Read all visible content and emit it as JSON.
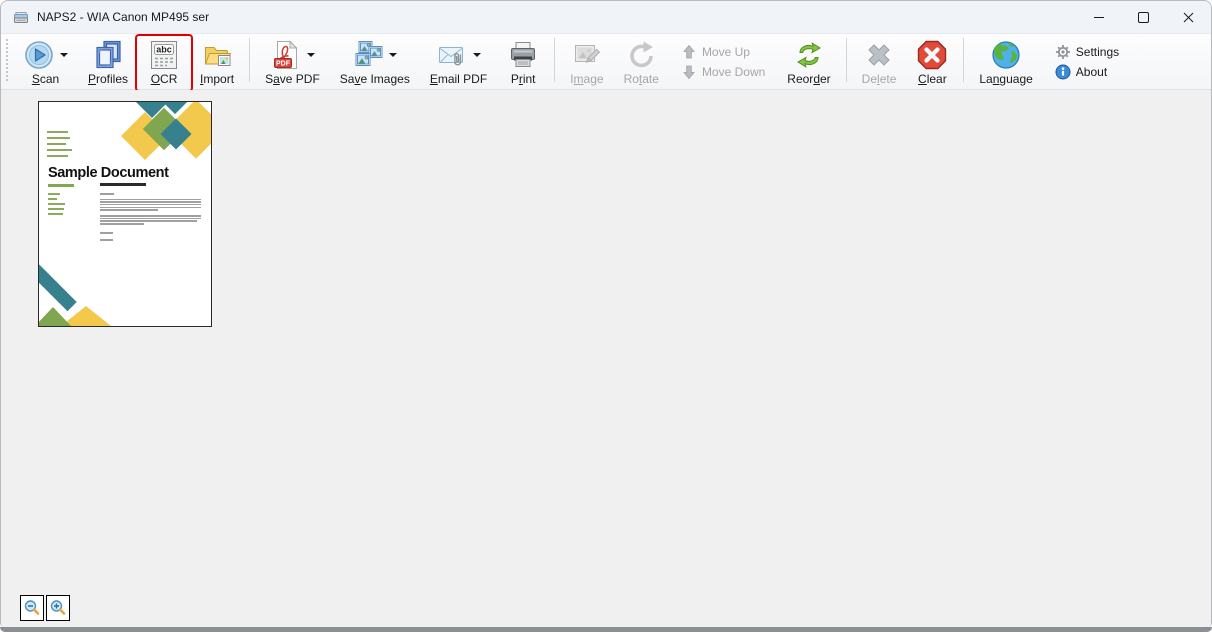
{
  "window": {
    "title": "NAPS2 - WIA Canon MP495 ser",
    "app_icon": "scanner-icon",
    "controls": [
      {
        "name": "minimize",
        "icon": "minimize-icon"
      },
      {
        "name": "maximize",
        "icon": "maximize-icon"
      },
      {
        "name": "close",
        "icon": "close-icon"
      }
    ]
  },
  "colors": {
    "ocr_highlight": "#e00000",
    "titlebar_bg": "#f0f3f8",
    "content_bg": "#f0f0f0",
    "disabled_text": "#a6a6a6",
    "window_border": "#8b8f94"
  },
  "toolbar": {
    "items": [
      {
        "type": "button",
        "name": "scan",
        "icon": "scan-icon",
        "label": {
          "pre": "",
          "key": "S",
          "post": "can"
        },
        "arrow": true,
        "enabled": true
      },
      {
        "type": "button",
        "name": "profiles",
        "icon": "profiles-icon",
        "label": {
          "pre": "",
          "key": "P",
          "post": "rofiles"
        },
        "enabled": true
      },
      {
        "type": "button",
        "name": "ocr",
        "icon": "ocr-icon",
        "label": {
          "pre": "",
          "key": "O",
          "post": "CR"
        },
        "enabled": true,
        "highlighted": true
      },
      {
        "type": "button",
        "name": "import",
        "icon": "import-icon",
        "label": {
          "pre": "",
          "key": "I",
          "post": "mport"
        },
        "enabled": true
      },
      {
        "type": "separator"
      },
      {
        "type": "button",
        "name": "save-pdf",
        "icon": "save-pdf-icon",
        "label": {
          "pre": "S",
          "key": "a",
          "post": "ve PDF"
        },
        "arrow": true,
        "enabled": true
      },
      {
        "type": "button",
        "name": "save-images",
        "icon": "save-images-icon",
        "label": {
          "pre": "Sa",
          "key": "v",
          "post": "e Images"
        },
        "arrow": true,
        "enabled": true
      },
      {
        "type": "button",
        "name": "email-pdf",
        "icon": "email-pdf-icon",
        "label": {
          "pre": "",
          "key": "E",
          "post": "mail PDF"
        },
        "arrow": true,
        "enabled": true
      },
      {
        "type": "button",
        "name": "print",
        "icon": "print-icon",
        "label": {
          "pre": "P",
          "key": "r",
          "post": "int"
        },
        "enabled": true
      },
      {
        "type": "separator"
      },
      {
        "type": "button",
        "name": "image",
        "icon": "image-icon",
        "label": {
          "pre": "I",
          "key": "m",
          "post": "age"
        },
        "enabled": false
      },
      {
        "type": "button",
        "name": "rotate",
        "icon": "rotate-icon",
        "label": {
          "pre": "Ro",
          "key": "t",
          "post": "ate"
        },
        "enabled": false
      },
      {
        "type": "stack",
        "items": [
          {
            "name": "move-up",
            "icon": "move-up-icon",
            "label": {
              "pre": "Move Up",
              "key": "",
              "post": ""
            },
            "enabled": false
          },
          {
            "name": "move-down",
            "icon": "move-down-icon",
            "label": {
              "pre": "Move Down",
              "key": "",
              "post": ""
            },
            "enabled": false
          }
        ]
      },
      {
        "type": "button",
        "name": "reorder",
        "icon": "reorder-icon",
        "label": {
          "pre": "Reor",
          "key": "d",
          "post": "er"
        },
        "enabled": true
      },
      {
        "type": "separator"
      },
      {
        "type": "button",
        "name": "delete",
        "icon": "delete-icon",
        "label": {
          "pre": "De",
          "key": "l",
          "post": "ete"
        },
        "enabled": false
      },
      {
        "type": "button",
        "name": "clear",
        "icon": "clear-icon",
        "label": {
          "pre": "",
          "key": "C",
          "post": "lear"
        },
        "enabled": true
      },
      {
        "type": "separator"
      },
      {
        "type": "button",
        "name": "language",
        "icon": "language-icon",
        "label": {
          "pre": "La",
          "key": "n",
          "post": "guage"
        },
        "enabled": true
      },
      {
        "type": "stack",
        "items": [
          {
            "name": "settings",
            "icon": "settings-icon",
            "label": {
              "pre": "Settings",
              "key": "",
              "post": ""
            },
            "enabled": true
          },
          {
            "name": "about",
            "icon": "about-icon",
            "label": {
              "pre": "About",
              "key": "",
              "post": ""
            },
            "enabled": true
          }
        ]
      }
    ]
  },
  "content": {
    "thumbnail": {
      "title": "Sample Document"
    }
  },
  "zoom_controls": {
    "buttons": [
      {
        "name": "zoom-out",
        "icon": "zoom-out-icon"
      },
      {
        "name": "zoom-in",
        "icon": "zoom-in-icon"
      }
    ]
  }
}
